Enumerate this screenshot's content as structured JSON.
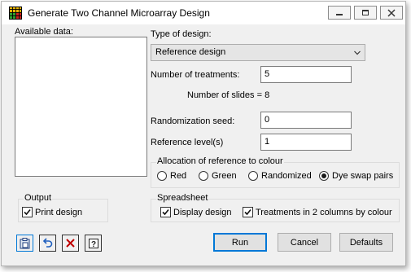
{
  "window": {
    "title": "Generate Two Channel Microarray Design"
  },
  "available_data": {
    "label": "Available data:"
  },
  "design": {
    "type_label": "Type of design:",
    "type_value": "Reference design",
    "treatments_label": "Number of treatments:",
    "treatments_value": "5",
    "slides_text": "Number of slides = 8",
    "seed_label": "Randomization seed:",
    "seed_value": "0",
    "reference_label": "Reference level(s)",
    "reference_value": "1"
  },
  "allocation": {
    "title": "Allocation of reference to colour",
    "options": [
      "Red",
      "Green",
      "Randomized",
      "Dye swap pairs"
    ],
    "selected": "Dye swap pairs"
  },
  "output": {
    "title": "Output",
    "print_design_label": "Print design",
    "print_design_checked": true
  },
  "spreadsheet": {
    "title": "Spreadsheet",
    "display_design_label": "Display design",
    "display_design_checked": true,
    "two_columns_label": "Treatments in 2 columns by colour",
    "two_columns_checked": true
  },
  "buttons": {
    "run": "Run",
    "cancel": "Cancel",
    "defaults": "Defaults"
  },
  "toolbar_icons": [
    "copy-to-clipboard-icon",
    "undo-icon",
    "clear-icon",
    "help-icon"
  ],
  "colors": {
    "dialog_bg": "#f0f0f0",
    "accent": "#0078d7",
    "clear_icon": "#c00000",
    "undo_icon": "#1f5fbf"
  }
}
